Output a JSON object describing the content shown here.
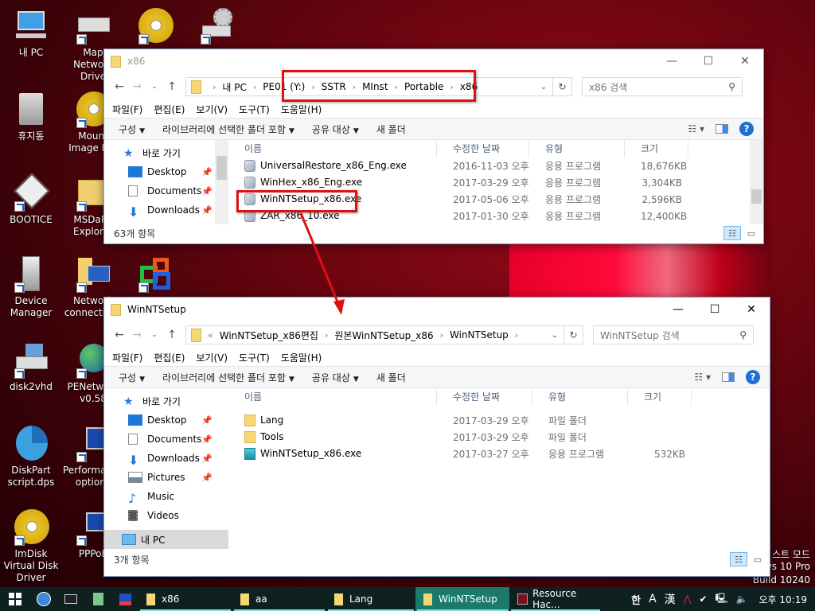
{
  "desktop": {
    "icons": [
      {
        "label": "내 PC",
        "icon": "computer-icon"
      },
      {
        "label": "Map Network Drive",
        "icon": "network-drive-icon"
      },
      {
        "label": "",
        "icon": "disc-icon"
      },
      {
        "label": "",
        "icon": "drive-gear-icon"
      },
      {
        "label": "휴지통",
        "icon": "recycle-bin-icon"
      },
      {
        "label": "Mount Image File",
        "icon": "disc-icon"
      },
      {
        "label": "BOOTICE",
        "icon": "floppy-icon"
      },
      {
        "label": "MSDaRT Explorer",
        "icon": "folder-icon"
      },
      {
        "label": "Device Manager",
        "icon": "device-manager-icon"
      },
      {
        "label": "Network connections",
        "icon": "network-icon"
      },
      {
        "label": "",
        "icon": "resource-icon"
      },
      {
        "label": "disk2vhd",
        "icon": "disk-icon"
      },
      {
        "label": "PENetwork v0.58",
        "icon": "globe-icon"
      },
      {
        "label": "DiskPart script.dps",
        "icon": "pie-disk-icon"
      },
      {
        "label": "Performance options",
        "icon": "performance-icon"
      },
      {
        "label": "ImDisk Virtual Disk Driver",
        "icon": "disc-icon"
      },
      {
        "label": "PPPoE",
        "icon": "network-icon"
      }
    ],
    "watermark": [
      "스트 모드",
      "ws 10 Pro",
      "Build 10240"
    ]
  },
  "window1": {
    "title": "x86",
    "breadcrumb": [
      "내 PC",
      "PE01 (Y:)",
      "SSTR",
      "MInst",
      "Portable",
      "x86"
    ],
    "search_placeholder": "x86 검색",
    "menu": [
      "파일(F)",
      "편집(E)",
      "보기(V)",
      "도구(T)",
      "도움말(H)"
    ],
    "commands": [
      "구성",
      "라이브러리에 선택한 폴더 포함",
      "공유 대상",
      "새 폴더"
    ],
    "nav": [
      {
        "label": "바로 가기"
      },
      {
        "label": "Desktop"
      },
      {
        "label": "Documents"
      },
      {
        "label": "Downloads"
      }
    ],
    "columns": [
      "이름",
      "수정한 날짜",
      "유형",
      "크기"
    ],
    "files": [
      {
        "name": "UniversalRestore_x86_Eng.exe",
        "date": "2016-11-03 오후 7:...",
        "type": "응용 프로그램",
        "size": "18,676KB"
      },
      {
        "name": "WinHex_x86_Eng.exe",
        "date": "2017-03-29 오후 3:...",
        "type": "응용 프로그램",
        "size": "3,304KB"
      },
      {
        "name": "WinNTSetup_x86.exe",
        "date": "2017-05-06 오후 9:...",
        "type": "응용 프로그램",
        "size": "2,596KB"
      },
      {
        "name": "ZAR_x86_10.exe",
        "date": "2017-01-30 오후 7:...",
        "type": "응용 프로그램",
        "size": "12,400KB"
      }
    ],
    "status": "63개 항목"
  },
  "window2": {
    "title": "WinNTSetup",
    "breadcrumb_prefix": "«",
    "breadcrumb": [
      "WinNTSetup_x86편집",
      "원본WinNTSetup_x86",
      "WinNTSetup"
    ],
    "search_placeholder": "WinNTSetup 검색",
    "menu": [
      "파일(F)",
      "편집(E)",
      "보기(V)",
      "도구(T)",
      "도움말(H)"
    ],
    "commands": [
      "구성",
      "라이브러리에 선택한 폴더 포함",
      "공유 대상",
      "새 폴더"
    ],
    "nav": [
      {
        "label": "바로 가기"
      },
      {
        "label": "Desktop"
      },
      {
        "label": "Documents"
      },
      {
        "label": "Downloads"
      },
      {
        "label": "Pictures"
      },
      {
        "label": "Music"
      },
      {
        "label": "Videos"
      },
      {
        "label": "내 PC"
      }
    ],
    "columns": [
      "이름",
      "수정한 날짜",
      "유형",
      "크기"
    ],
    "files": [
      {
        "name": "Lang",
        "date": "2017-03-29 오후 1:...",
        "type": "파일 폴더",
        "size": ""
      },
      {
        "name": "Tools",
        "date": "2017-03-29 오후 1:...",
        "type": "파일 폴더",
        "size": ""
      },
      {
        "name": "WinNTSetup_x86.exe",
        "date": "2017-03-27 오후 7:...",
        "type": "응용 프로그램",
        "size": "532KB"
      }
    ],
    "status": "3개 항목"
  },
  "taskbar": {
    "tasks": [
      {
        "label": "x86",
        "active": false
      },
      {
        "label": "aa",
        "active": false
      },
      {
        "label": "Lang",
        "active": false
      },
      {
        "label": "WinNTSetup",
        "active": true
      },
      {
        "label": "Resource Hac...",
        "active": false
      }
    ],
    "tray": {
      "ime1": "한",
      "ime2": "A",
      "ime3": "漢",
      "clock": "오후 10:19"
    }
  },
  "colors": {
    "highlight": "#e01010",
    "taskbar": "#0f2020",
    "active_task": "#1b7a6a"
  }
}
